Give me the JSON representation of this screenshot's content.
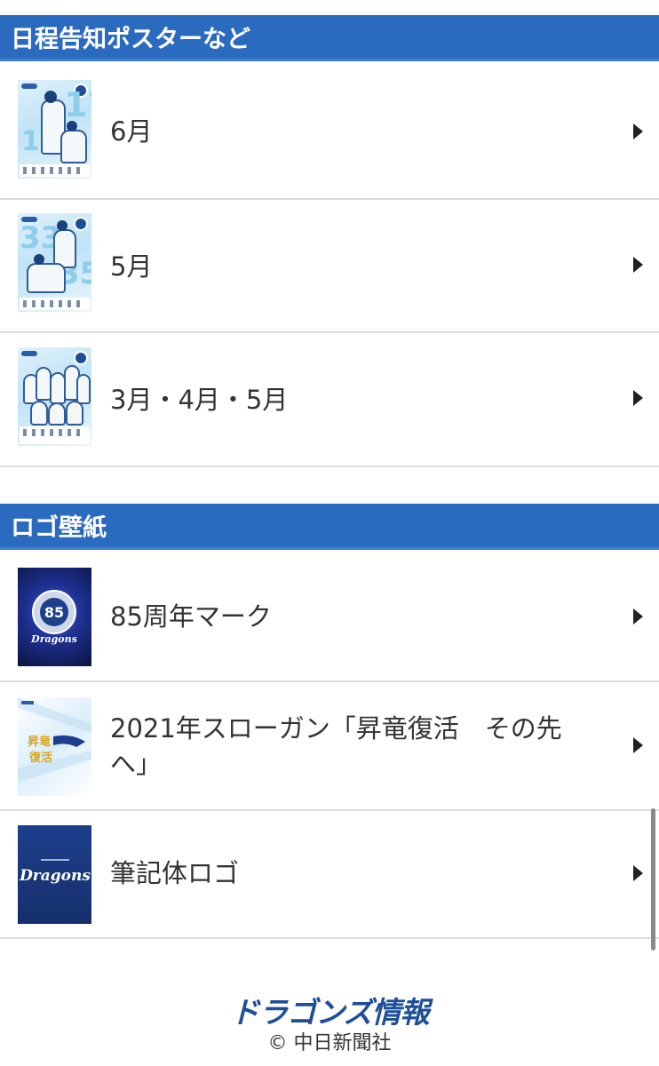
{
  "sections": [
    {
      "title": "日程告知ポスターなど",
      "items": [
        {
          "label": "6月",
          "thumb_icon": "schedule-poster-june"
        },
        {
          "label": "5月",
          "thumb_icon": "schedule-poster-may"
        },
        {
          "label": "3月・4月・5月",
          "thumb_icon": "schedule-poster-march-april-may"
        }
      ]
    },
    {
      "title": "ロゴ壁紙",
      "items": [
        {
          "label": "85周年マーク",
          "thumb_icon": "anniversary-85-logo"
        },
        {
          "label": "2021年スローガン「昇竜復活　その先へ」",
          "thumb_icon": "slogan-2021"
        },
        {
          "label": "筆記体ロゴ",
          "thumb_icon": "script-logo"
        }
      ]
    }
  ],
  "footer": {
    "brand": "ドラゴンズ情報",
    "copyright": "© 中日新聞社"
  },
  "colors": {
    "header_bg": "#2b6bbf",
    "footer_brand": "#1f4e98"
  }
}
